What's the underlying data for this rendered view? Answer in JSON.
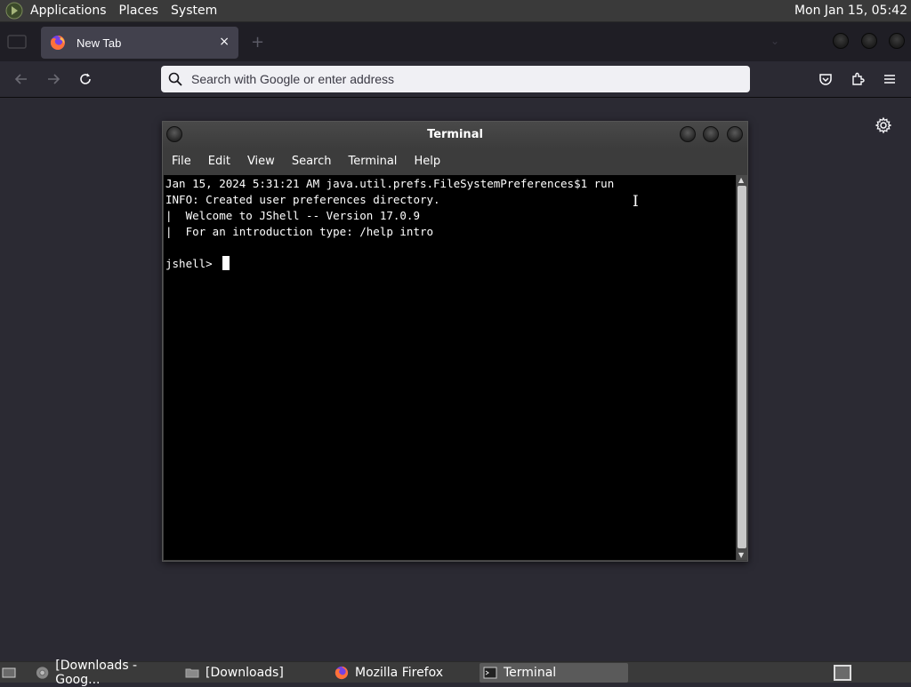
{
  "top_panel": {
    "menus": [
      "Applications",
      "Places",
      "System"
    ],
    "clock": "Mon Jan 15, 05:42"
  },
  "browser": {
    "tab": {
      "title": "New Tab",
      "close": "×"
    },
    "new_tab": "+",
    "urlbar": {
      "placeholder": "Search with Google or enter address",
      "value": ""
    }
  },
  "terminal": {
    "title": "Terminal",
    "menu": [
      "File",
      "Edit",
      "View",
      "Search",
      "Terminal",
      "Help"
    ],
    "lines": [
      "Jan 15, 2024 5:31:21 AM java.util.prefs.FileSystemPreferences$1 run",
      "INFO: Created user preferences directory.",
      "|  Welcome to JShell -- Version 17.0.9",
      "|  For an introduction type: /help intro",
      ""
    ],
    "prompt": "jshell> "
  },
  "taskbar": {
    "items": [
      "[Downloads - Goog...",
      "[Downloads]",
      "Mozilla Firefox",
      "Terminal"
    ]
  },
  "icons": {
    "panel_logo": "gnome-foot-icon",
    "tab_favicon": "firefox-icon",
    "back": "arrow-left-icon",
    "forward": "arrow-right-icon",
    "reload": "reload-icon",
    "search": "search-icon",
    "pocket": "pocket-icon",
    "extensions": "puzzle-icon",
    "menu": "hamburger-icon",
    "settings": "gear-icon"
  },
  "colors": {
    "browser_bg": "#2b2a33",
    "panel_bg": "#3a3a3a",
    "terminal_bg": "#000000"
  }
}
